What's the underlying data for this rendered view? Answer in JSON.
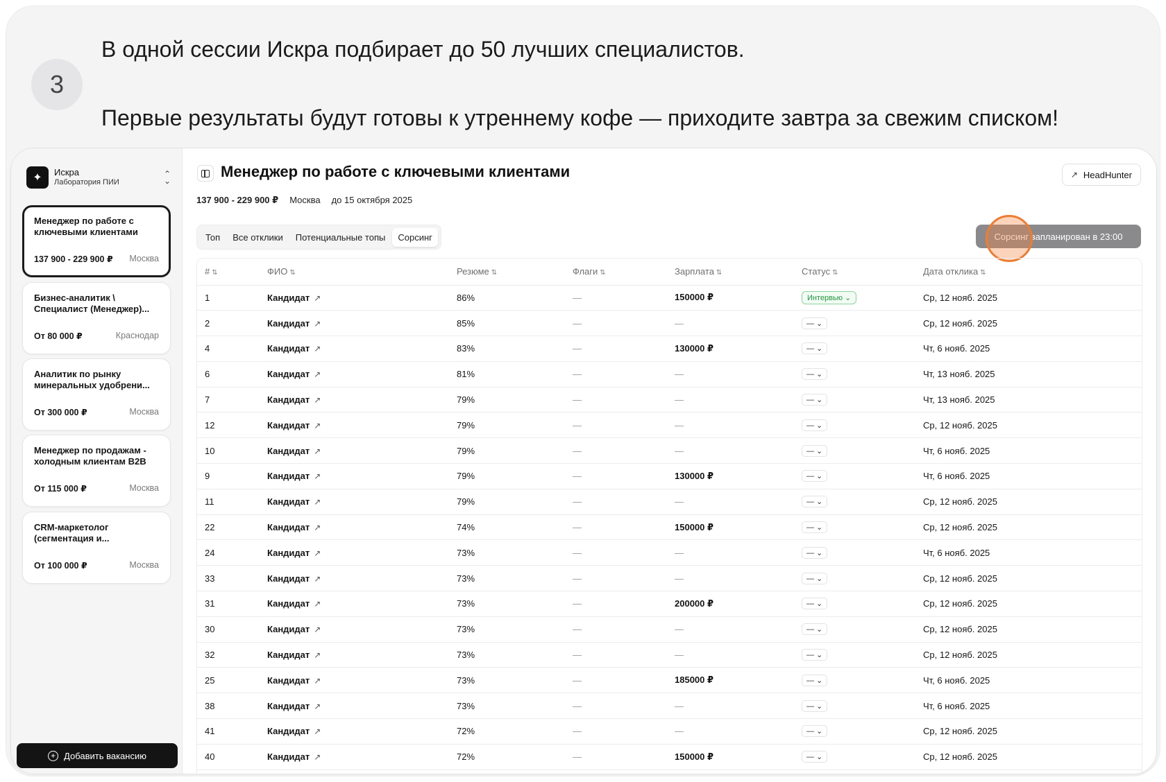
{
  "step": {
    "number": "3",
    "line1": "В одной сессии Искра подбирает до 50 лучших специалистов.",
    "line2": "Первые результаты будут готовы к утреннему кофе — приходите завтра за свежим списком!"
  },
  "sidebar": {
    "org_name": "Искра",
    "org_subtitle": "Лаборатория ПИИ",
    "add_button": "Добавить вакансию",
    "vacancies": [
      {
        "title": "Менеджер по работе с ключевыми клиентами",
        "salary": "137 900 - 229 900 ₽",
        "city": "Москва",
        "active": true
      },
      {
        "title": "Бизнес-аналитик \\ Специалист (Менеджер)...",
        "salary": "От 80 000 ₽",
        "city": "Краснодар"
      },
      {
        "title": "Аналитик по рынку минеральных удобрени...",
        "salary": "От 300 000 ₽",
        "city": "Москва"
      },
      {
        "title": "Менеджер по продажам - холодным клиентам B2B",
        "salary": "От 115 000 ₽",
        "city": "Москва"
      },
      {
        "title": "CRM-маркетолог (сегментация и...",
        "salary": "От 100 000 ₽",
        "city": "Москва"
      }
    ]
  },
  "header": {
    "title": "Менеджер по работе с ключевыми клиентами",
    "salary": "137 900 - 229 900 ₽",
    "city": "Москва",
    "deadline": "до 15 октября 2025",
    "hh_button": "HeadHunter"
  },
  "tabs": [
    "Топ",
    "Все отклики",
    "Потенциальные топы",
    "Сорсинг"
  ],
  "active_tab": "Сорсинг",
  "sourcing_button": "Сорсинг запланирован в 23:00",
  "table": {
    "columns": [
      "#",
      "ФИО",
      "Резюме",
      "Флаги",
      "Зарплата",
      "Статус",
      "Дата отклика"
    ],
    "rows": [
      {
        "num": "1",
        "name": "Кандидат",
        "resume": "86%",
        "flags": "—",
        "salary": "150000 ₽",
        "status": "Интервью",
        "date": "Ср, 12 нояб. 2025"
      },
      {
        "num": "2",
        "name": "Кандидат",
        "resume": "85%",
        "flags": "—",
        "salary": "—",
        "status": "—",
        "date": "Ср, 12 нояб. 2025"
      },
      {
        "num": "4",
        "name": "Кандидат",
        "resume": "83%",
        "flags": "—",
        "salary": "130000 ₽",
        "status": "—",
        "date": "Чт, 6 нояб. 2025"
      },
      {
        "num": "6",
        "name": "Кандидат",
        "resume": "81%",
        "flags": "—",
        "salary": "—",
        "status": "—",
        "date": "Чт, 13 нояб. 2025"
      },
      {
        "num": "7",
        "name": "Кандидат",
        "resume": "79%",
        "flags": "—",
        "salary": "—",
        "status": "—",
        "date": "Чт, 13 нояб. 2025"
      },
      {
        "num": "12",
        "name": "Кандидат",
        "resume": "79%",
        "flags": "—",
        "salary": "—",
        "status": "—",
        "date": "Ср, 12 нояб. 2025"
      },
      {
        "num": "10",
        "name": "Кандидат",
        "resume": "79%",
        "flags": "—",
        "salary": "—",
        "status": "—",
        "date": "Чт, 6 нояб. 2025"
      },
      {
        "num": "9",
        "name": "Кандидат",
        "resume": "79%",
        "flags": "—",
        "salary": "130000 ₽",
        "status": "—",
        "date": "Чт, 6 нояб. 2025"
      },
      {
        "num": "11",
        "name": "Кандидат",
        "resume": "79%",
        "flags": "—",
        "salary": "—",
        "status": "—",
        "date": "Ср, 12 нояб. 2025"
      },
      {
        "num": "22",
        "name": "Кандидат",
        "resume": "74%",
        "flags": "—",
        "salary": "150000 ₽",
        "status": "—",
        "date": "Ср, 12 нояб. 2025"
      },
      {
        "num": "24",
        "name": "Кандидат",
        "resume": "73%",
        "flags": "—",
        "salary": "—",
        "status": "—",
        "date": "Чт, 6 нояб. 2025"
      },
      {
        "num": "33",
        "name": "Кандидат",
        "resume": "73%",
        "flags": "—",
        "salary": "—",
        "status": "—",
        "date": "Ср, 12 нояб. 2025"
      },
      {
        "num": "31",
        "name": "Кандидат",
        "resume": "73%",
        "flags": "—",
        "salary": "200000 ₽",
        "status": "—",
        "date": "Ср, 12 нояб. 2025"
      },
      {
        "num": "30",
        "name": "Кандидат",
        "resume": "73%",
        "flags": "—",
        "salary": "—",
        "status": "—",
        "date": "Ср, 12 нояб. 2025"
      },
      {
        "num": "32",
        "name": "Кандидат",
        "resume": "73%",
        "flags": "—",
        "salary": "—",
        "status": "—",
        "date": "Ср, 12 нояб. 2025"
      },
      {
        "num": "25",
        "name": "Кандидат",
        "resume": "73%",
        "flags": "—",
        "salary": "185000 ₽",
        "status": "—",
        "date": "Чт, 6 нояб. 2025"
      },
      {
        "num": "38",
        "name": "Кандидат",
        "resume": "73%",
        "flags": "—",
        "salary": "—",
        "status": "—",
        "date": "Чт, 6 нояб. 2025"
      },
      {
        "num": "41",
        "name": "Кандидат",
        "resume": "72%",
        "flags": "—",
        "salary": "—",
        "status": "—",
        "date": "Ср, 12 нояб. 2025"
      },
      {
        "num": "40",
        "name": "Кандидат",
        "resume": "72%",
        "flags": "—",
        "salary": "150000 ₽",
        "status": "—",
        "date": "Ср, 12 нояб. 2025"
      }
    ]
  },
  "colors": {
    "primary_dark": "#141414",
    "status_green": "#1f9a3d",
    "click_marker": "#ee7d34"
  }
}
